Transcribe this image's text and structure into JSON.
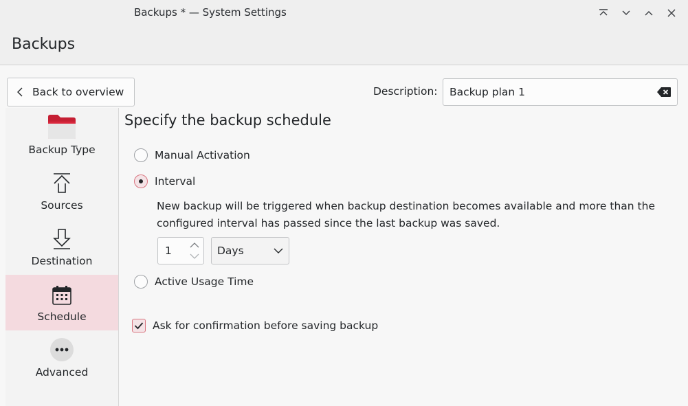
{
  "window": {
    "title": "Backups * — System Settings",
    "controls": [
      "keep-above",
      "minimize",
      "maximize",
      "close"
    ]
  },
  "header": {
    "title": "Backups"
  },
  "back_button": {
    "label": "Back to overview"
  },
  "description": {
    "label": "Description:",
    "value": "Backup plan 1"
  },
  "sidebar": {
    "items": [
      {
        "label": "Backup Type",
        "icon": "folder-icon",
        "active": false
      },
      {
        "label": "Sources",
        "icon": "upload-icon",
        "active": false
      },
      {
        "label": "Destination",
        "icon": "download-icon",
        "active": false
      },
      {
        "label": "Schedule",
        "icon": "calendar-icon",
        "active": true
      },
      {
        "label": "Advanced",
        "icon": "more-icon",
        "active": false
      }
    ]
  },
  "schedule": {
    "title": "Specify the backup schedule",
    "options": {
      "manual": {
        "label": "Manual Activation",
        "checked": false
      },
      "interval": {
        "label": "Interval",
        "checked": true
      },
      "usage": {
        "label": "Active Usage Time",
        "checked": false
      }
    },
    "interval_help": "New backup will be triggered when backup destination becomes available and more than the configured interval has passed since the last backup was saved.",
    "interval_value": "1",
    "interval_unit": "Days",
    "ask_confirmation": {
      "label": "Ask for confirmation before saving backup",
      "checked": true
    }
  },
  "colors": {
    "accent": "#d9747f",
    "selection": "#f4dadf",
    "folder_red": "#d9263c"
  }
}
